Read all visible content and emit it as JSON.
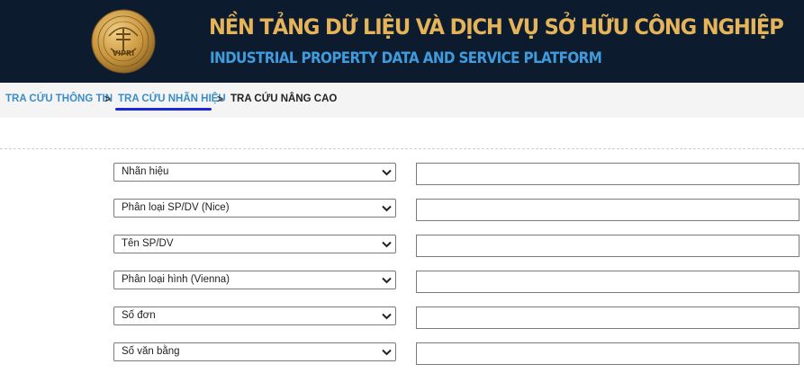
{
  "header": {
    "title_vi": "NỀN TẢNG DỮ LIỆU VÀ DỊCH VỤ SỞ HỮU CÔNG NGHIỆP",
    "title_en": "INDUSTRIAL PROPERTY DATA AND SERVICE PLATFORM",
    "logo_text": "VIPRI",
    "logo_color": "#c9973e"
  },
  "breadcrumb": {
    "items": [
      {
        "label": "TRA CỨU THÔNG TIN"
      },
      {
        "label": "TRA CỨU NHÃN HIỆU"
      },
      {
        "label": "TRA CỨU NÂNG CAO"
      }
    ],
    "separator": ">"
  },
  "search_form": {
    "rows": [
      {
        "field_label": "Nhãn hiệu",
        "value": ""
      },
      {
        "field_label": "Phân loại SP/DV (Nice)",
        "value": ""
      },
      {
        "field_label": "Tên SP/DV",
        "value": ""
      },
      {
        "field_label": "Phân loại hình (Vienna)",
        "value": ""
      },
      {
        "field_label": "Số đơn",
        "value": ""
      },
      {
        "field_label": "Số văn bằng",
        "value": ""
      }
    ]
  },
  "colors": {
    "header_bg": "#0c1c2e",
    "title_vi": "#e5b45a",
    "title_en": "#3f9bdc",
    "breadcrumb_link": "#3a8dc4",
    "active_underline": "#1a28d8"
  }
}
